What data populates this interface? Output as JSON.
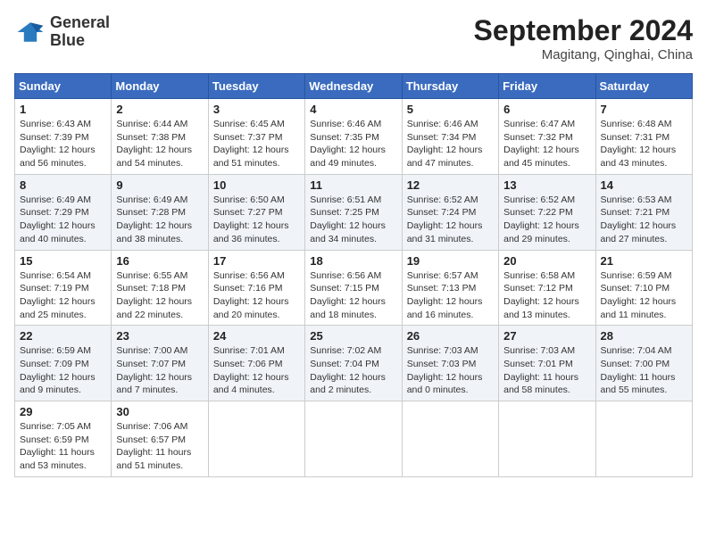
{
  "header": {
    "logo_line1": "General",
    "logo_line2": "Blue",
    "month": "September 2024",
    "location": "Magitang, Qinghai, China"
  },
  "weekdays": [
    "Sunday",
    "Monday",
    "Tuesday",
    "Wednesday",
    "Thursday",
    "Friday",
    "Saturday"
  ],
  "weeks": [
    [
      {
        "day": "1",
        "sunrise": "6:43 AM",
        "sunset": "7:39 PM",
        "daylight": "12 hours and 56 minutes."
      },
      {
        "day": "2",
        "sunrise": "6:44 AM",
        "sunset": "7:38 PM",
        "daylight": "12 hours and 54 minutes."
      },
      {
        "day": "3",
        "sunrise": "6:45 AM",
        "sunset": "7:37 PM",
        "daylight": "12 hours and 51 minutes."
      },
      {
        "day": "4",
        "sunrise": "6:46 AM",
        "sunset": "7:35 PM",
        "daylight": "12 hours and 49 minutes."
      },
      {
        "day": "5",
        "sunrise": "6:46 AM",
        "sunset": "7:34 PM",
        "daylight": "12 hours and 47 minutes."
      },
      {
        "day": "6",
        "sunrise": "6:47 AM",
        "sunset": "7:32 PM",
        "daylight": "12 hours and 45 minutes."
      },
      {
        "day": "7",
        "sunrise": "6:48 AM",
        "sunset": "7:31 PM",
        "daylight": "12 hours and 43 minutes."
      }
    ],
    [
      {
        "day": "8",
        "sunrise": "6:49 AM",
        "sunset": "7:29 PM",
        "daylight": "12 hours and 40 minutes."
      },
      {
        "day": "9",
        "sunrise": "6:49 AM",
        "sunset": "7:28 PM",
        "daylight": "12 hours and 38 minutes."
      },
      {
        "day": "10",
        "sunrise": "6:50 AM",
        "sunset": "7:27 PM",
        "daylight": "12 hours and 36 minutes."
      },
      {
        "day": "11",
        "sunrise": "6:51 AM",
        "sunset": "7:25 PM",
        "daylight": "12 hours and 34 minutes."
      },
      {
        "day": "12",
        "sunrise": "6:52 AM",
        "sunset": "7:24 PM",
        "daylight": "12 hours and 31 minutes."
      },
      {
        "day": "13",
        "sunrise": "6:52 AM",
        "sunset": "7:22 PM",
        "daylight": "12 hours and 29 minutes."
      },
      {
        "day": "14",
        "sunrise": "6:53 AM",
        "sunset": "7:21 PM",
        "daylight": "12 hours and 27 minutes."
      }
    ],
    [
      {
        "day": "15",
        "sunrise": "6:54 AM",
        "sunset": "7:19 PM",
        "daylight": "12 hours and 25 minutes."
      },
      {
        "day": "16",
        "sunrise": "6:55 AM",
        "sunset": "7:18 PM",
        "daylight": "12 hours and 22 minutes."
      },
      {
        "day": "17",
        "sunrise": "6:56 AM",
        "sunset": "7:16 PM",
        "daylight": "12 hours and 20 minutes."
      },
      {
        "day": "18",
        "sunrise": "6:56 AM",
        "sunset": "7:15 PM",
        "daylight": "12 hours and 18 minutes."
      },
      {
        "day": "19",
        "sunrise": "6:57 AM",
        "sunset": "7:13 PM",
        "daylight": "12 hours and 16 minutes."
      },
      {
        "day": "20",
        "sunrise": "6:58 AM",
        "sunset": "7:12 PM",
        "daylight": "12 hours and 13 minutes."
      },
      {
        "day": "21",
        "sunrise": "6:59 AM",
        "sunset": "7:10 PM",
        "daylight": "12 hours and 11 minutes."
      }
    ],
    [
      {
        "day": "22",
        "sunrise": "6:59 AM",
        "sunset": "7:09 PM",
        "daylight": "12 hours and 9 minutes."
      },
      {
        "day": "23",
        "sunrise": "7:00 AM",
        "sunset": "7:07 PM",
        "daylight": "12 hours and 7 minutes."
      },
      {
        "day": "24",
        "sunrise": "7:01 AM",
        "sunset": "7:06 PM",
        "daylight": "12 hours and 4 minutes."
      },
      {
        "day": "25",
        "sunrise": "7:02 AM",
        "sunset": "7:04 PM",
        "daylight": "12 hours and 2 minutes."
      },
      {
        "day": "26",
        "sunrise": "7:03 AM",
        "sunset": "7:03 PM",
        "daylight": "12 hours and 0 minutes."
      },
      {
        "day": "27",
        "sunrise": "7:03 AM",
        "sunset": "7:01 PM",
        "daylight": "11 hours and 58 minutes."
      },
      {
        "day": "28",
        "sunrise": "7:04 AM",
        "sunset": "7:00 PM",
        "daylight": "11 hours and 55 minutes."
      }
    ],
    [
      {
        "day": "29",
        "sunrise": "7:05 AM",
        "sunset": "6:59 PM",
        "daylight": "11 hours and 53 minutes."
      },
      {
        "day": "30",
        "sunrise": "7:06 AM",
        "sunset": "6:57 PM",
        "daylight": "11 hours and 51 minutes."
      },
      null,
      null,
      null,
      null,
      null
    ]
  ]
}
